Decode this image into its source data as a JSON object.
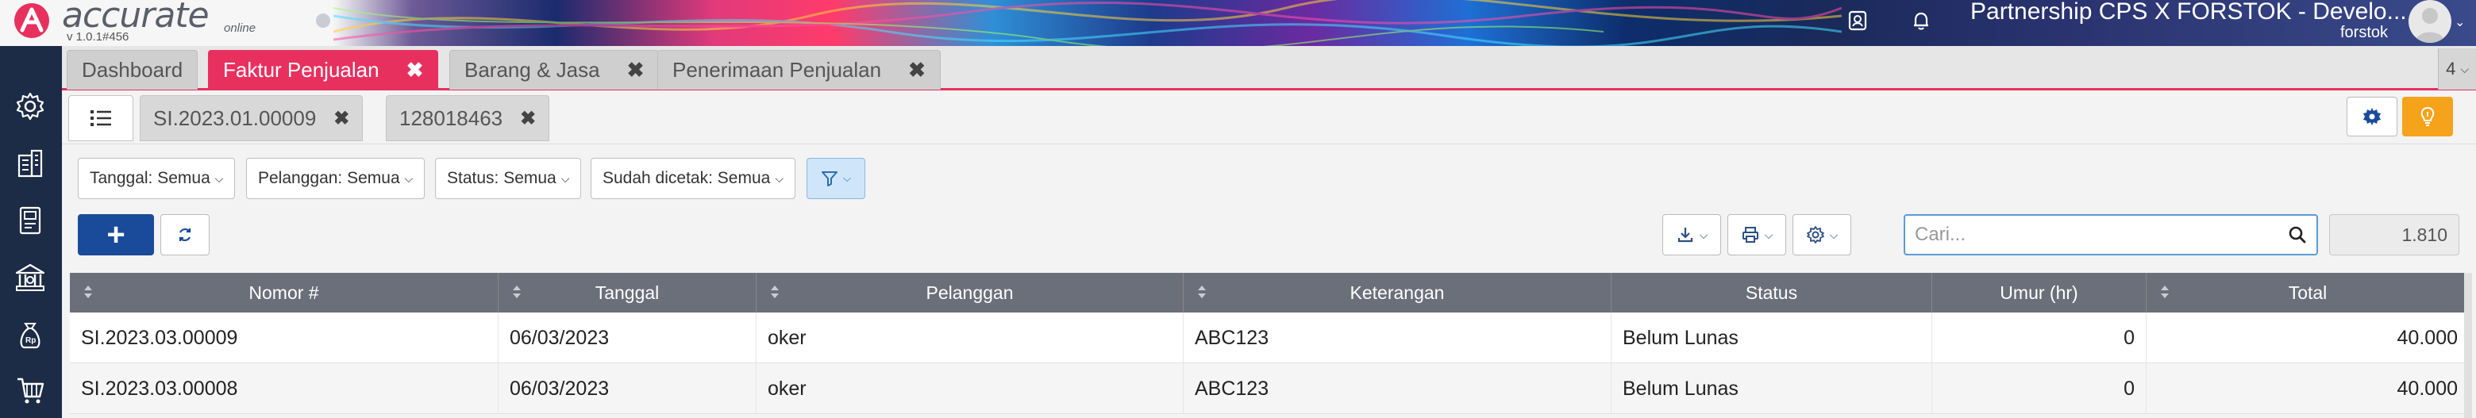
{
  "app": {
    "logo_text": "accurate",
    "logo_sub": "online",
    "version": "v 1.0.1#456",
    "company": "Partnership CPS X FORSTOK - Develo...",
    "user": "forstok"
  },
  "main_tabs": [
    {
      "label": "Dashboard",
      "closable": false,
      "active": false
    },
    {
      "label": "Faktur Penjualan",
      "closable": true,
      "active": true
    },
    {
      "label": "Barang & Jasa",
      "closable": true,
      "active": false
    },
    {
      "label": "Penerimaan Penjualan",
      "closable": true,
      "active": false
    }
  ],
  "tab_count": "4",
  "sub_tabs": [
    {
      "label": "SI.2023.01.00009"
    },
    {
      "label": "128018463"
    }
  ],
  "filters": [
    {
      "label": "Tanggal: Semua"
    },
    {
      "label": "Pelanggan: Semua"
    },
    {
      "label": "Status: Semua"
    },
    {
      "label": "Sudah dicetak: Semua"
    }
  ],
  "toolbar": {
    "add_label": "+",
    "search_placeholder": "Cari...",
    "record_count": "1.810"
  },
  "table": {
    "columns": [
      "Nomor #",
      "Tanggal",
      "Pelanggan",
      "Keterangan",
      "Status",
      "Umur (hr)",
      "Total"
    ],
    "rows": [
      {
        "nomor": "SI.2023.03.00009",
        "tanggal": "06/03/2023",
        "pelanggan": "oker",
        "keterangan": "ABC123",
        "status": "Belum Lunas",
        "umur": "0",
        "total": "40.000"
      },
      {
        "nomor": "SI.2023.03.00008",
        "tanggal": "06/03/2023",
        "pelanggan": "oker",
        "keterangan": "ABC123",
        "status": "Belum Lunas",
        "umur": "0",
        "total": "40.000"
      }
    ]
  },
  "colors": {
    "accent": "#e8305e",
    "primary": "#1a4a9a",
    "sidebar": "#1c2b46",
    "warning": "#f5a31a"
  },
  "icons": {
    "sidebar": [
      "gear-icon",
      "building-icon",
      "book-icon",
      "bank-icon",
      "money-bag-icon",
      "cart-icon"
    ]
  }
}
